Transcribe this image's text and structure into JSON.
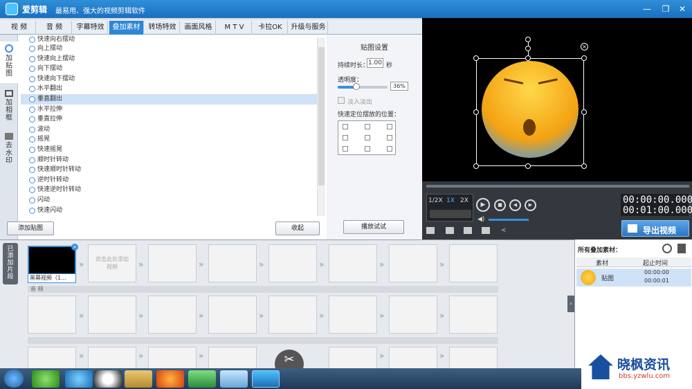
{
  "app": {
    "name": "爱剪辑",
    "slogan": "最易用、强大的视频剪辑软件"
  },
  "window": {
    "minimize": "—",
    "restore": "❐",
    "close": "✕"
  },
  "tabs": [
    "视 频",
    "音 频",
    "字幕特效",
    "叠加素材",
    "转场特效",
    "画面风格",
    "M T V",
    "卡拉OK",
    "升级与服务"
  ],
  "sidetabs": [
    "加贴图",
    "加相框",
    "去水印"
  ],
  "effects": [
    "快速向右摆动",
    "向上摆动",
    "快速向上摆动",
    "向下摆动",
    "快速向下摆动",
    "水平翻出",
    "垂直翻出",
    "水平拉伸",
    "垂直拉伸",
    "波动",
    "摇晃",
    "快速摇晃",
    "顺时针转动",
    "快速顺时针转动",
    "逆时针转动",
    "快速逆时针转动",
    "闪动",
    "快速闪动"
  ],
  "left_buttons": {
    "add": "添加贴图",
    "collapse": "收起"
  },
  "props": {
    "title": "贴图设置",
    "duration_label": "持续时长：",
    "duration_value": "1.00",
    "duration_unit": "秒",
    "opacity_label": "透明度：",
    "opacity_value": "36%",
    "fade_label": "淡入淡出",
    "position_label": "快速定位摆放的位置：",
    "play_btn": "播放试试"
  },
  "player": {
    "speeds": [
      "1/2X",
      "1X",
      "2X"
    ],
    "time_current": "00:00:00.000",
    "time_total": "00:01:00.000",
    "export": "导出视频"
  },
  "timeline": {
    "side_label": "已添加片段",
    "clip_label": "黑幕视频（1...",
    "drop_hint": "双击此处添加视频",
    "audio_label": "音 频"
  },
  "material_list": {
    "title": "所有叠加素材：",
    "col1": "素材",
    "col2": "起止时间",
    "row_name": "贴图",
    "row_start": "00:00:00",
    "row_end": "00:00:01"
  },
  "watermark": {
    "brand": "晓枫资讯",
    "url": "bbs.yzwlu.com"
  },
  "colors": {
    "accent": "#2d86d6",
    "export": "#3a8ee0"
  }
}
